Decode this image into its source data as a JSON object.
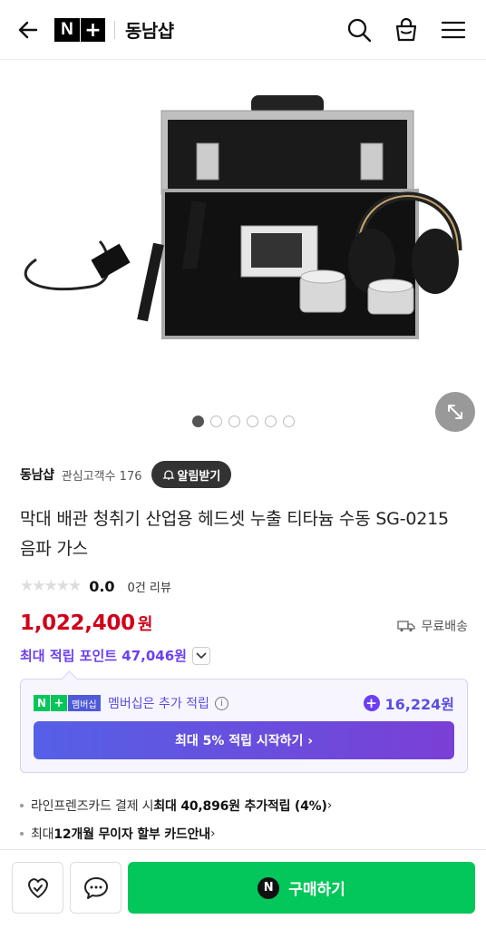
{
  "header": {
    "logo_n": "N",
    "logo_plus": "+",
    "store_title": "동남샵",
    "icons": [
      "back-arrow-icon",
      "search-icon",
      "cart-icon",
      "menu-icon"
    ]
  },
  "gallery": {
    "current_index": 1,
    "total": 6
  },
  "store": {
    "name": "동남샵",
    "fans": "관심고객수 176",
    "alarm_label": "알림받기"
  },
  "product": {
    "title": "막대 배관 청취기 산업용 헤드셋 누출 티타늄 수동 SG-0215 음파 가스",
    "stars": "★★★★★",
    "score": "0.0",
    "reviews": "0건 리뷰",
    "price": "1,022,400",
    "currency": "원",
    "shipping": "무료배송",
    "points": "최대 적립 포인트 47,046원"
  },
  "membership": {
    "logo_n": "N",
    "logo_plus": "+",
    "logo_tag": "멤버십",
    "text": "멤버십은 추가 적립",
    "amount": "16,224원",
    "cta": "최대 5% 적립 시작하기 ›"
  },
  "benefits": {
    "line1_pre": "라인프렌즈카드 결제 시 ",
    "line1_bold": "최대 40,896원 추가적립 (4%)",
    "line1_post": " ›",
    "line2_pre": "최대 ",
    "line2_bold": "12개월 무이자 할부 카드안내",
    "line2_post": " ›"
  },
  "bottom": {
    "buy_badge": "N",
    "buy_label": "구매하기"
  },
  "colors": {
    "price": "#d0021b",
    "accent": "#6b3ff2",
    "buy": "#03c75a"
  }
}
